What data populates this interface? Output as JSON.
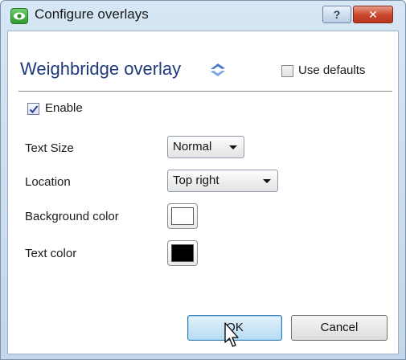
{
  "window": {
    "title": "Configure overlays",
    "help_label": "?",
    "close_label": "✕"
  },
  "header": {
    "title": "Weighbridge overlay",
    "use_defaults_label": "Use defaults",
    "use_defaults_checked": false
  },
  "form": {
    "enable_label": "Enable",
    "enable_checked": true,
    "text_size_label": "Text Size",
    "text_size_value": "Normal",
    "location_label": "Location",
    "location_value": "Top right",
    "background_color_label": "Background color",
    "background_color_value": "#ffffff",
    "text_color_label": "Text color",
    "text_color_value": "#000000"
  },
  "footer": {
    "ok_label": "OK",
    "cancel_label": "Cancel"
  },
  "colors": {
    "heading": "#1f3a7a",
    "ok_button_border": "#3c7fb1",
    "close_button": "#c9452a"
  },
  "icons": {
    "app": "eye-icon",
    "refresh": "refresh-icon",
    "checkmark": "checkmark-icon",
    "cursor": "mouse-pointer-icon"
  }
}
